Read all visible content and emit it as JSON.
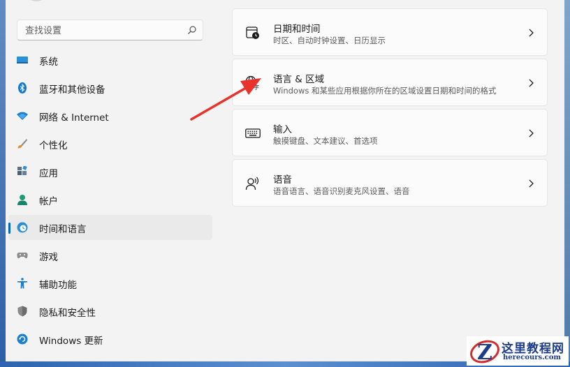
{
  "search": {
    "placeholder": "查找设置"
  },
  "sidebar": {
    "items": [
      {
        "label": "系统",
        "icon": "system-monitor-icon"
      },
      {
        "label": "蓝牙和其他设备",
        "icon": "bluetooth-icon"
      },
      {
        "label": "网络 & Internet",
        "icon": "wifi-icon"
      },
      {
        "label": "个性化",
        "icon": "brush-icon"
      },
      {
        "label": "应用",
        "icon": "apps-icon"
      },
      {
        "label": "帐户",
        "icon": "account-icon"
      },
      {
        "label": "时间和语言",
        "icon": "time-language-icon",
        "selected": true
      },
      {
        "label": "游戏",
        "icon": "gamepad-icon"
      },
      {
        "label": "辅助功能",
        "icon": "accessibility-icon"
      },
      {
        "label": "隐私和安全性",
        "icon": "shield-icon"
      },
      {
        "label": "Windows 更新",
        "icon": "windows-update-icon"
      }
    ]
  },
  "main": {
    "cards": [
      {
        "title": "日期和时间",
        "subtitle": "时区、自动时钟设置、日历显示",
        "icon": "calendar-clock-icon"
      },
      {
        "title": "语言 & 区域",
        "subtitle": "Windows 和某些应用根据你所在的区域设置日期和时间的格式",
        "icon": "language-region-icon"
      },
      {
        "title": "输入",
        "subtitle": "触摸键盘、文本建议、首选项",
        "icon": "keyboard-icon"
      },
      {
        "title": "语音",
        "subtitle": "语音语言、语音识别麦克风设置、语音",
        "icon": "speech-icon"
      }
    ]
  },
  "colors": {
    "accent": "#0067c0",
    "annotation_arrow": "#e8322b",
    "background": "#f3f3f3",
    "card": "#fbfbfb"
  },
  "watermark": {
    "title": "这里教程网",
    "url": "herecours.com"
  }
}
